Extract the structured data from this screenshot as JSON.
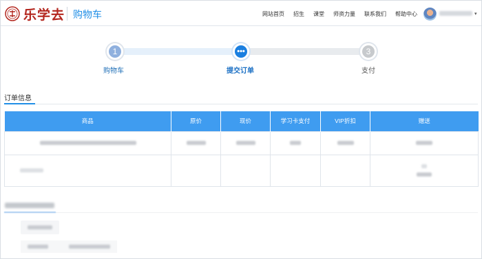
{
  "header": {
    "logo_text": "乐学去",
    "page_title": "购物车",
    "nav": [
      "网站首页",
      "招生",
      "课堂",
      "师资力量",
      "联系我们",
      "帮助中心"
    ],
    "caret": "▾"
  },
  "steps": [
    {
      "number": "1",
      "label": "购物车",
      "state": "done"
    },
    {
      "number": "•••",
      "label": "提交订单",
      "state": "current"
    },
    {
      "number": "3",
      "label": "支付",
      "state": "todo"
    }
  ],
  "order_section": {
    "title": "订单信息",
    "columns": [
      "商品",
      "原价",
      "现价",
      "学习卡支付",
      "VIP折扣",
      "赠送"
    ]
  },
  "colors": {
    "accent": "#1f8ee6",
    "table_header": "#3f9cf0",
    "logo_red": "#b3261e"
  }
}
